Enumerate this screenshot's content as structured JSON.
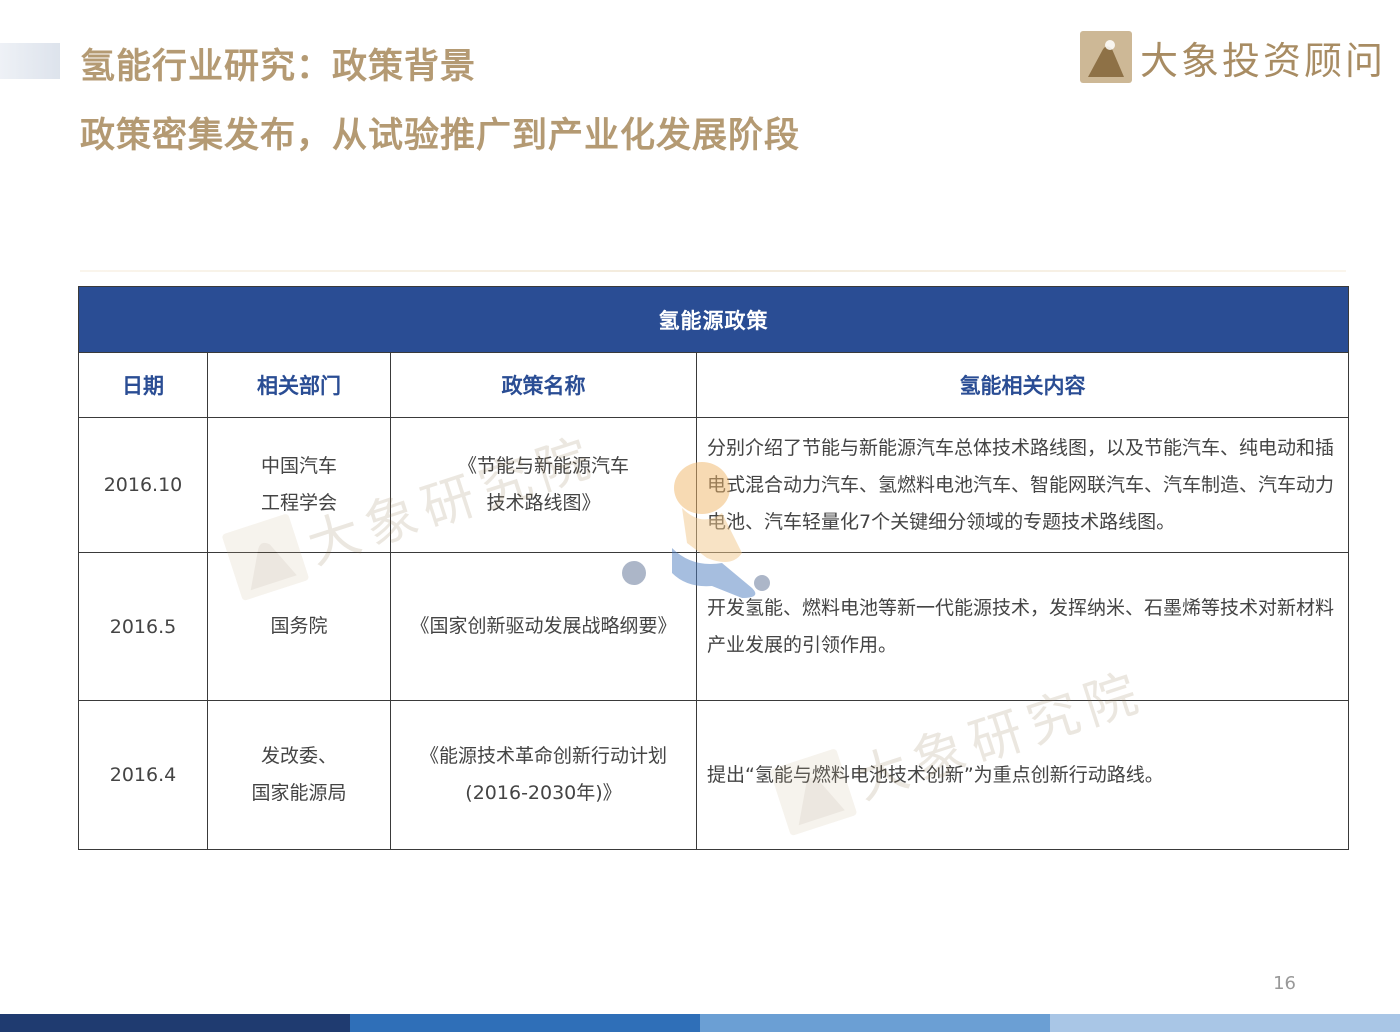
{
  "header": {
    "title": "氢能行业研究：政策背景",
    "subtitle": "政策密集发布，从试验推广到产业化发展阶段",
    "brand_name": "大象投资顾问"
  },
  "table": {
    "caption": "氢能源政策",
    "columns": [
      "日期",
      "相关部门",
      "政策名称",
      "氢能相关内容"
    ],
    "rows": [
      {
        "date": "2016.10",
        "department_line1": "中国汽车",
        "department_line2": "工程学会",
        "policy_line1": "《节能与新能源汽车",
        "policy_line2": "技术路线图》",
        "content": "分别介绍了节能与新能源汽车总体技术路线图，以及节能汽车、纯电动和插电式混合动力汽车、氢燃料电池汽车、智能网联汽车、汽车制造、汽车动力电池、汽车轻量化7个关键细分领域的专题技术路线图。"
      },
      {
        "date": "2016.5",
        "department_line1": "国务院",
        "policy_line1": "《国家创新驱动发展战略纲要》",
        "content": "开发氢能、燃料电池等新一代能源技术，发挥纳米、石墨烯等技术对新材料产业发展的引领作用。"
      },
      {
        "date": "2016.4",
        "department_line1": "发改委、",
        "department_line2": "国家能源局",
        "policy_line1": "《能源技术革命创新行动计划",
        "policy_line2": "(2016-2030年)》",
        "content": "提出“氢能与燃料电池技术创新”为重点创新行动路线。"
      }
    ]
  },
  "watermark": {
    "text_1": "大象研究院",
    "text_2": "大象研究院"
  },
  "page_number": "16",
  "colors": {
    "title": "#b49a73",
    "table_header_bg": "#2a4d94",
    "table_header_text": "#2a4d94",
    "footer": [
      "#1f3b70",
      "#2f6fb8",
      "#6b9fd4",
      "#a9c6e6"
    ]
  }
}
